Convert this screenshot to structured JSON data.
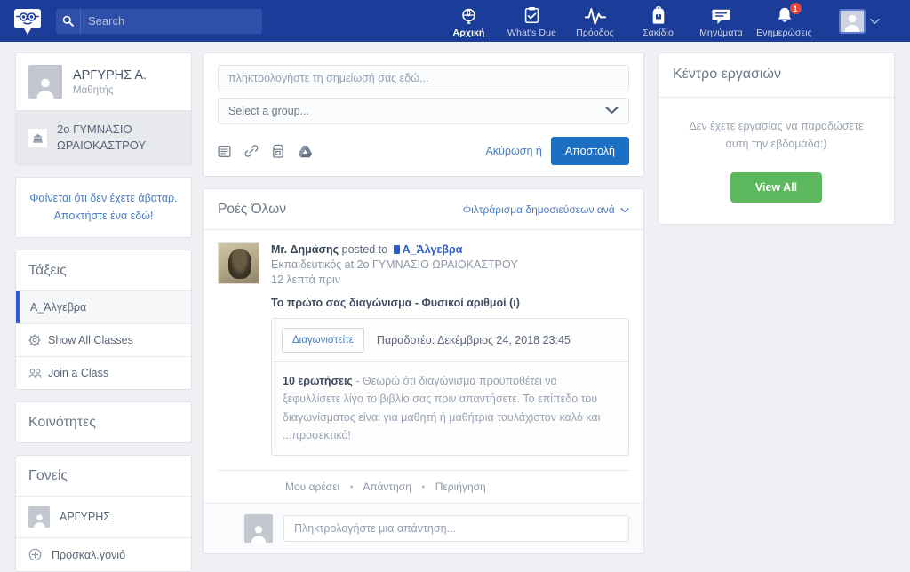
{
  "topbar": {
    "logo_icon": "edmodo-logo-icon",
    "search": {
      "placeholder": "Search",
      "value": "",
      "icon": "search-icon"
    },
    "nav": [
      {
        "label": "Αρχική",
        "icon": "home-icon",
        "active": true,
        "badge": ""
      },
      {
        "label": "What's Due",
        "icon": "clipboard-check-icon",
        "active": false,
        "badge": ""
      },
      {
        "label": "Πρόοδος",
        "icon": "pulse-icon",
        "active": false,
        "badge": ""
      },
      {
        "label": "Σακίδιο",
        "icon": "backpack-icon",
        "active": false,
        "badge": ""
      },
      {
        "label": "Μηνύματα",
        "icon": "chat-bubble-icon",
        "active": false,
        "badge": ""
      },
      {
        "label": "Ενημερώσεις",
        "icon": "bell-icon",
        "active": false,
        "badge": "1"
      }
    ],
    "user_menu": {
      "avatar_icon": "user-avatar-icon",
      "chevron_icon": "chevron-down-icon"
    },
    "accent_color": "#1b3c99",
    "badge_color": "#e8453c"
  },
  "sidebar": {
    "profile": {
      "name": "ΑΡΓΥΡΗΣ Α.",
      "role": "Μαθητής",
      "avatar_icon": "user-avatar-icon"
    },
    "school": {
      "name": "2ο ΓΥΜΝΑΣΙΟ ΩΡΑΙΟΚΑΣΤΡΟΥ",
      "icon": "school-icon"
    },
    "avatar_prompt": {
      "line1": "Φαίνεται ότι δεν έχετε άβαταρ.",
      "line2": "Αποκτήστε ένα εδώ!"
    },
    "classes": {
      "title": "Τάξεις",
      "items": [
        {
          "label": "Α_Άλγεβρα",
          "icon": "",
          "selected": true
        },
        {
          "label": "Show All Classes",
          "icon": "gear-icon",
          "selected": false
        },
        {
          "label": "Join a Class",
          "icon": "people-icon",
          "selected": false
        }
      ]
    },
    "communities": {
      "title": "Κοινότητες"
    },
    "parents": {
      "title": "Γονείς",
      "items": [
        {
          "label": "ΑΡΓΥΡΗΣ",
          "icon": "user-avatar-icon"
        },
        {
          "label": "Προσκαλ.γονιό",
          "icon": "plus-circle-icon"
        }
      ]
    }
  },
  "composer": {
    "note_placeholder": "πληκτρολογήστε τη σημείωσή σας εδώ...",
    "note_value": "",
    "group_placeholder": "Select a group...",
    "group_chevron_icon": "chevron-down-icon",
    "attachments": [
      {
        "icon": "note-icon"
      },
      {
        "icon": "link-icon"
      },
      {
        "icon": "backpack-icon"
      },
      {
        "icon": "google-drive-icon"
      }
    ],
    "cancel_label": "Ακύρωση ή",
    "send_label": "Αποστολή"
  },
  "feed": {
    "title": "Ροές Όλων",
    "filter_label": "Φιλτράρισμα δημοσιεύσεων ανά",
    "filter_chevron_icon": "chevron-down-icon",
    "post": {
      "author": "Mr. Δημάσης",
      "posted_to_text": "posted to",
      "group": "Α_Άλγεβρα",
      "subtitle": "Εκπαιδευτικός at 2ο ΓΥΜΝΑΣΙΟ ΩΡΑΙΟΚΑΣΤΡΟΥ",
      "time": "12 λεπτά πριν",
      "avatar_icon": "teacher-photo-avatar",
      "quiz_title": "Το πρώτο σας διαγώνισμα - Φυσικοί αριθμοί (ι)",
      "quiz_button": "Διαγωνιστείτε",
      "quiz_due": "Παραδοτέο: Δεκέμβριος 24, 2018 23:45",
      "quiz_count": "10 ερωτήσεις",
      "quiz_desc": " - Θεωρώ ότι διαγώνισμα προϋποθέτει να ξεφυλλίσετε λίγο το βιβλίο σας πριν απαντήσετε. Το επίπεδο του διαγωνίσματος είναι για μαθητή ή μαθήτρια τουλάχιστον καλό και ...προσεκτικό!",
      "actions": [
        "Μου αρέσει",
        "Απάντηση",
        "Περιήγηση"
      ],
      "reply_placeholder": "Πληκτρολογήστε μια απάντηση...",
      "reply_avatar_icon": "user-avatar-icon"
    }
  },
  "right_panel": {
    "title": "Κέντρο εργασιών",
    "empty_text": "Δεν έχετε εργασίας να παραδώσετε αυτή την εβδομάδα:)",
    "button_label": "View All",
    "button_color": "#5cb85c"
  }
}
